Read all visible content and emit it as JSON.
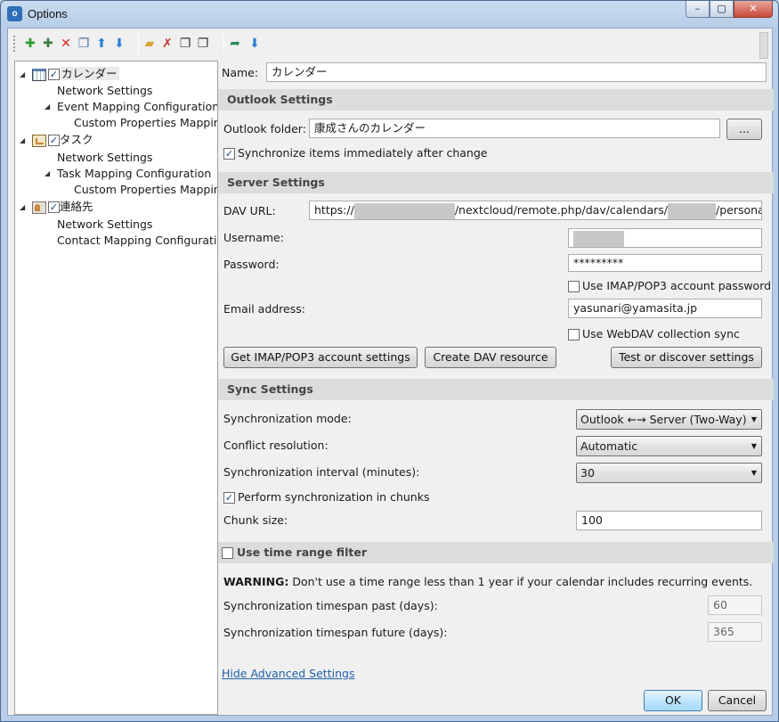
{
  "window": {
    "title": "Options",
    "app_icon_text": "o",
    "buttons": {
      "minimize": "–",
      "maximize": "▢",
      "close": "✕"
    }
  },
  "toolbar": {
    "items": [
      {
        "icon": "add-profile-icon",
        "glyph": "✚",
        "color": "#2e9a2e"
      },
      {
        "icon": "add-multiple-profiles-icon",
        "glyph": "✚",
        "color": "#3c7a3c"
      },
      {
        "icon": "delete-profile-icon",
        "glyph": "✕",
        "color": "#d12b1f"
      },
      {
        "icon": "copy-profile-icon",
        "glyph": "❐",
        "color": "#4a6fa5"
      },
      {
        "icon": "move-up-icon",
        "glyph": "⬆",
        "color": "#2f7fd6"
      },
      {
        "icon": "move-down-icon",
        "glyph": "⬇",
        "color": "#2f7fd6"
      },
      {
        "icon": "open-folder-icon",
        "glyph": "▰",
        "color": "#d9a735"
      },
      {
        "icon": "clear-cache-icon",
        "glyph": "✗",
        "color": "#c0392b"
      },
      {
        "icon": "expand-all-icon",
        "glyph": "❐",
        "color": "#333333"
      },
      {
        "icon": "collapse-all-icon",
        "glyph": "❐",
        "color": "#333333"
      },
      {
        "icon": "export-icon",
        "glyph": "➦",
        "color": "#2e8b57"
      },
      {
        "icon": "import-icon",
        "glyph": "⬇",
        "color": "#2f7fd6"
      }
    ]
  },
  "tree": {
    "profiles": [
      {
        "name": "カレンダー",
        "icon": "calendar-icon",
        "checked": true,
        "children": [
          {
            "label": "Network Settings"
          },
          {
            "label": "Event Mapping Configuration",
            "children": [
              {
                "label": "Custom Properties Mapping"
              }
            ]
          }
        ]
      },
      {
        "name": "タスク",
        "icon": "task-icon",
        "checked": true,
        "children": [
          {
            "label": "Network Settings"
          },
          {
            "label": "Task Mapping Configuration",
            "children": [
              {
                "label": "Custom Properties Mapping"
              }
            ]
          }
        ]
      },
      {
        "name": "連絡先",
        "icon": "contact-icon",
        "checked": true,
        "children": [
          {
            "label": "Network Settings"
          },
          {
            "label": "Contact Mapping Configuration"
          }
        ]
      }
    ]
  },
  "form": {
    "name_label": "Name:",
    "name_value": "カレンダー",
    "outlook_section": "Outlook Settings",
    "outlook_folder_label": "Outlook folder:",
    "outlook_folder_value": "康成さんのカレンダー",
    "browse_label": "...",
    "sync_immediately_label": "Synchronize items immediately after change",
    "sync_immediately_checked": true,
    "server_section": "Server Settings",
    "dav_url_label": "DAV URL:",
    "dav_url_prefix": "https://",
    "dav_url_middle": "/nextcloud/remote.php/dav/calendars/",
    "dav_url_suffix": "/personal/",
    "username_label": "Username:",
    "password_label": "Password:",
    "password_value": "*********",
    "use_imap_password_label": "Use IMAP/POP3 account password",
    "use_imap_password_checked": false,
    "email_label": "Email address:",
    "email_value": "yasunari@yamasita.jp",
    "webdav_collection_label": "Use WebDAV collection sync",
    "webdav_collection_checked": false,
    "get_imap_button": "Get IMAP/POP3 account settings",
    "create_dav_button": "Create DAV resource",
    "test_discover_button": "Test or discover settings",
    "sync_section": "Sync Settings",
    "sync_mode_label": "Synchronization mode:",
    "sync_mode_value": "Outlook ←→ Server (Two-Way)",
    "conflict_label": "Conflict resolution:",
    "conflict_value": "Automatic",
    "interval_label": "Synchronization interval (minutes):",
    "interval_value": "30",
    "chunks_label": "Perform synchronization in chunks",
    "chunks_checked": true,
    "chunk_size_label": "Chunk size:",
    "chunk_size_value": "100",
    "time_range_section": "Use time range filter",
    "time_range_checked": false,
    "warning_bold": "WARNING:",
    "warning_text": " Don't use a time range less than 1 year if your calendar includes recurring events.",
    "timespan_past_label": "Synchronization timespan past (days):",
    "timespan_past_value": "60",
    "timespan_future_label": "Synchronization timespan future (days):",
    "timespan_future_value": "365",
    "hide_advanced_link": "Hide Advanced Settings"
  },
  "footer": {
    "ok": "OK",
    "cancel": "Cancel"
  }
}
